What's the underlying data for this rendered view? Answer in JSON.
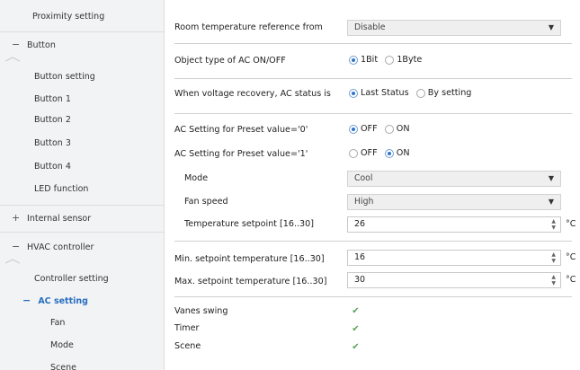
{
  "sidebar": {
    "items": [
      {
        "label": "Proximity setting"
      },
      {
        "label": "Button",
        "icon": "−"
      },
      {
        "label": "Button setting"
      },
      {
        "label": "Button 1"
      },
      {
        "label": "Button 2"
      },
      {
        "label": "Button 3"
      },
      {
        "label": "Button 4"
      },
      {
        "label": "LED function"
      },
      {
        "label": "Internal sensor",
        "icon": "+"
      },
      {
        "label": "HVAC controller",
        "icon": "−"
      },
      {
        "label": "Controller setting"
      },
      {
        "label": "AC setting",
        "icon": "−"
      },
      {
        "label": "Fan"
      },
      {
        "label": "Mode"
      },
      {
        "label": "Scene"
      }
    ]
  },
  "main": {
    "room_temp_ref": {
      "label": "Room temperature reference from",
      "value": "Disable"
    },
    "ac_onoff_type": {
      "label": "Object type of AC ON/OFF",
      "options": [
        "1Bit",
        "1Byte"
      ],
      "selected": "1Bit"
    },
    "voltage_recovery": {
      "label": "When voltage recovery, AC status is",
      "options": [
        "Last Status",
        "By setting"
      ],
      "selected": "Last Status"
    },
    "preset0": {
      "label": "AC Setting for Preset value='0'",
      "options": [
        "OFF",
        "ON"
      ],
      "selected": "OFF"
    },
    "preset1": {
      "label": "AC Setting for Preset value='1'",
      "options": [
        "OFF",
        "ON"
      ],
      "selected": "ON"
    },
    "mode": {
      "label": "Mode",
      "value": "Cool"
    },
    "fan_speed": {
      "label": "Fan speed",
      "value": "High"
    },
    "temp_setpoint": {
      "label": "Temperature setpoint [16..30]",
      "value": "26",
      "unit": "°C"
    },
    "min_setpoint": {
      "label": "Min. setpoint temperature [16..30]",
      "value": "16",
      "unit": "°C"
    },
    "max_setpoint": {
      "label": "Max. setpoint temperature [16..30]",
      "value": "30",
      "unit": "°C"
    },
    "vanes_swing": {
      "label": "Vanes swing",
      "checked": true
    },
    "timer": {
      "label": "Timer",
      "checked": true
    },
    "scene": {
      "label": "Scene",
      "checked": true
    }
  }
}
